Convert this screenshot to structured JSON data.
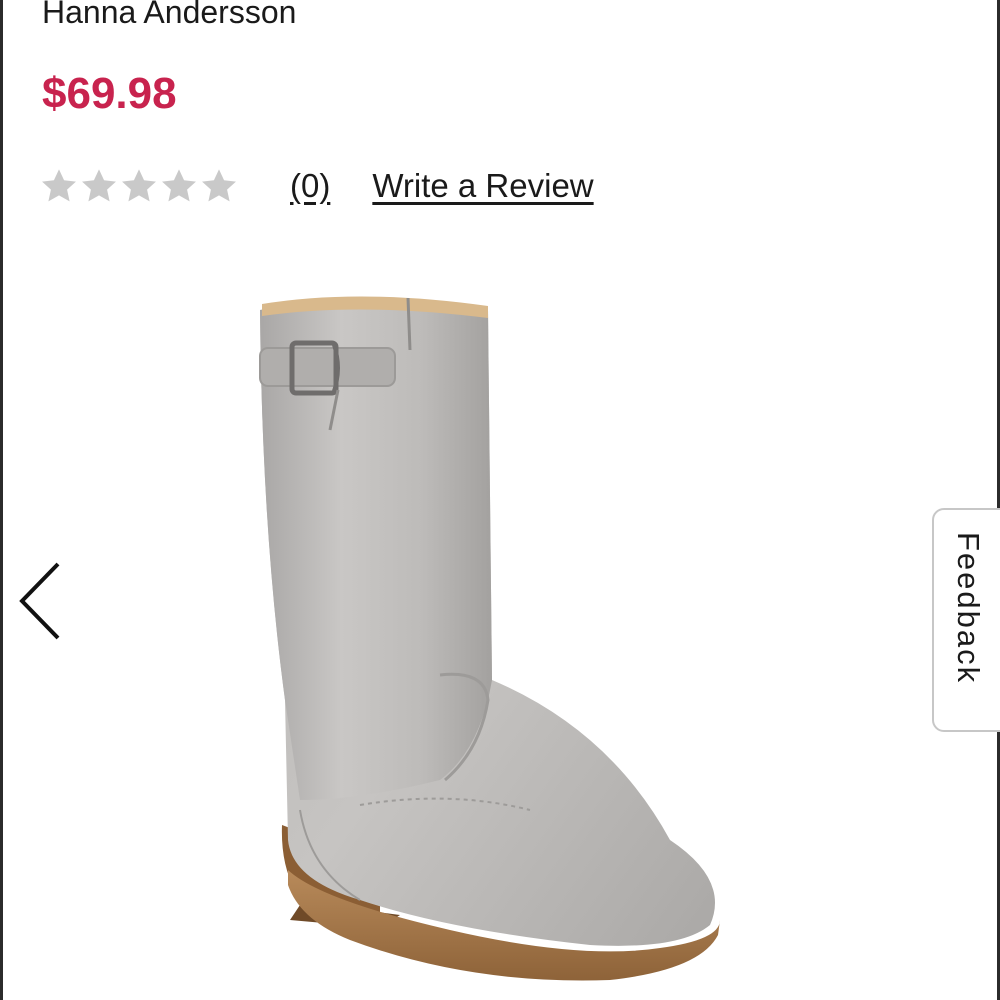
{
  "product": {
    "brand": "Hanna Andersson",
    "price": "$69.98",
    "price_color": "#c8234e",
    "rating": {
      "stars_filled": 0,
      "stars_total": 5,
      "star_empty_color": "#c9c9c9",
      "count_label": "(0)",
      "write_review_label": "Write a Review"
    },
    "image": {
      "icon": "gray-boot-image"
    }
  },
  "carousel": {
    "prev_icon": "chevron-left-icon"
  },
  "feedback": {
    "label": "Feedback"
  }
}
